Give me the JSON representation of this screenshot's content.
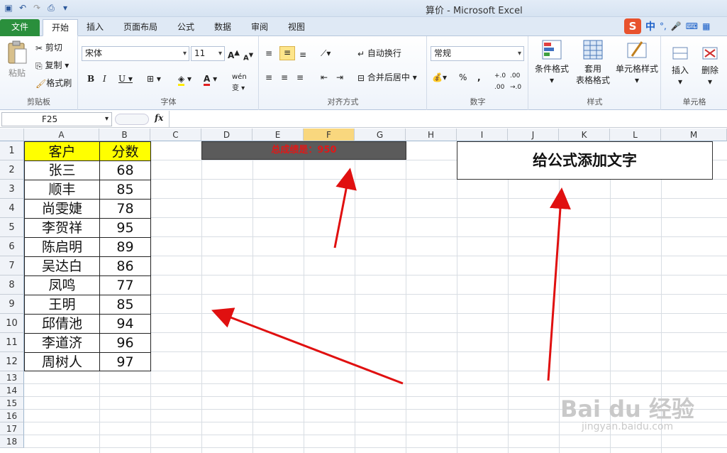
{
  "window": {
    "title": "算价 - Microsoft Excel"
  },
  "tabs": [
    "文件",
    "开始",
    "插入",
    "页面布局",
    "公式",
    "数据",
    "审阅",
    "视图"
  ],
  "ribbon": {
    "clipboard": {
      "paste": "粘贴",
      "cut": "剪切",
      "copy": "复制",
      "format_painter": "格式刷",
      "label": "剪贴板"
    },
    "font": {
      "name": "宋体",
      "size": "11",
      "label": "字体"
    },
    "alignment": {
      "wrap": "自动换行",
      "merge": "合并后居中",
      "label": "对齐方式"
    },
    "number": {
      "format": "常规",
      "percent": "%",
      "comma": ",",
      "label": "数字"
    },
    "styles": {
      "conditional": "条件格式",
      "table_line1": "套用",
      "table_line2": "表格格式",
      "cell_styles": "单元格样式",
      "label": "样式"
    },
    "cells": {
      "insert": "插入",
      "delete": "删除",
      "label": "单元格"
    }
  },
  "formula_bar": {
    "name_box": "F25",
    "fx": "fx",
    "value": ""
  },
  "columns": [
    "A",
    "B",
    "C",
    "D",
    "E",
    "F",
    "G",
    "H",
    "I",
    "J",
    "K",
    "L",
    "M"
  ],
  "rows": [
    "1",
    "2",
    "3",
    "4",
    "5",
    "6",
    "7",
    "8",
    "9",
    "10",
    "11",
    "12",
    "13",
    "14",
    "15",
    "16",
    "17",
    "18"
  ],
  "table": {
    "headers": [
      "客户",
      "分数"
    ],
    "rows": [
      [
        "张三",
        "68"
      ],
      [
        "顺丰",
        "85"
      ],
      [
        "尚雯婕",
        "78"
      ],
      [
        "李贺祥",
        "95"
      ],
      [
        "陈启明",
        "89"
      ],
      [
        "吴达白",
        "86"
      ],
      [
        "凤鸣",
        "77"
      ],
      [
        "王明",
        "85"
      ],
      [
        "邱倩池",
        "94"
      ],
      [
        "李道济",
        "96"
      ],
      [
        "周树人",
        "97"
      ]
    ]
  },
  "result_cell": "总成绩是：950",
  "callout": "给公式添加文字",
  "ime": {
    "lang": "中"
  },
  "watermark": {
    "brand": "Bai du 经验",
    "url": "jingyan.baidu.com"
  }
}
